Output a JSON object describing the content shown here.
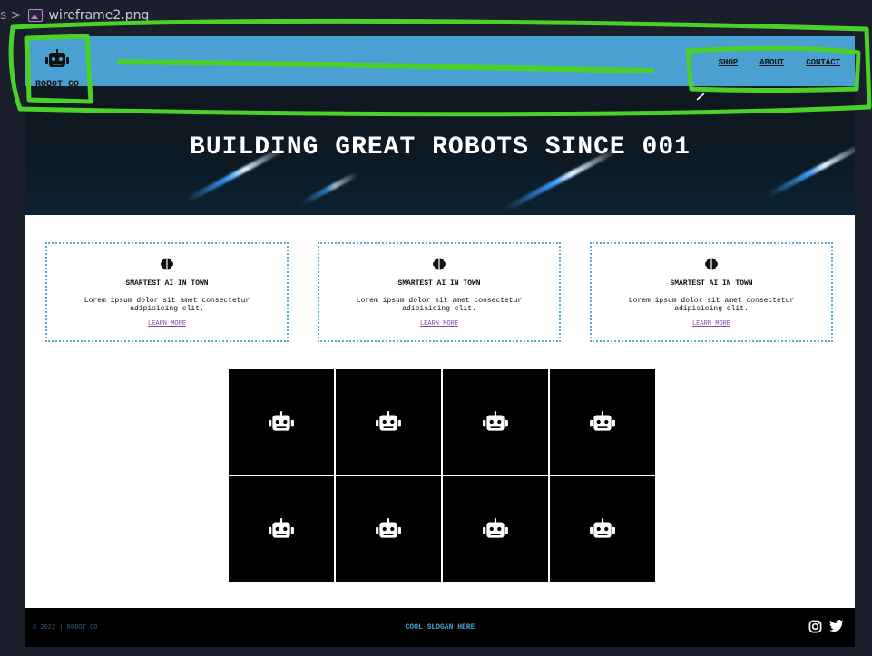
{
  "editor": {
    "breadcrumb_prev": "s >",
    "file_name": "wireframe2.png"
  },
  "header": {
    "logo_text": "ROBOT CO",
    "nav": [
      "SHOP",
      "ABOUT",
      "CONTACT"
    ]
  },
  "hero": {
    "title": "BUILDING GREAT ROBOTS SINCE 001"
  },
  "features": [
    {
      "title": "SMARTEST AI IN TOWN",
      "text": "Lorem ipsum dolor sit amet consectetur adipisicing elit.",
      "link": "LEARN MORE"
    },
    {
      "title": "SMARTEST AI IN TOWN",
      "text": "Lorem ipsum dolor sit amet consectetur adipisicing elit.",
      "link": "LEARN MORE"
    },
    {
      "title": "SMARTEST AI IN TOWN",
      "text": "Lorem ipsum dolor sit amet consectetur adipisicing elit.",
      "link": "LEARN MORE"
    }
  ],
  "footer": {
    "copyright": "© 2022 | ROBOT CO",
    "slogan": "COOL SLOGAN HERE"
  },
  "colors": {
    "navbar": "#4aa0d0",
    "annotation": "#4cd12a",
    "editor_bg": "#1b1e2b"
  },
  "icons": [
    "robot-icon",
    "brain-icon",
    "instagram-icon",
    "twitter-icon",
    "image-file-icon"
  ]
}
